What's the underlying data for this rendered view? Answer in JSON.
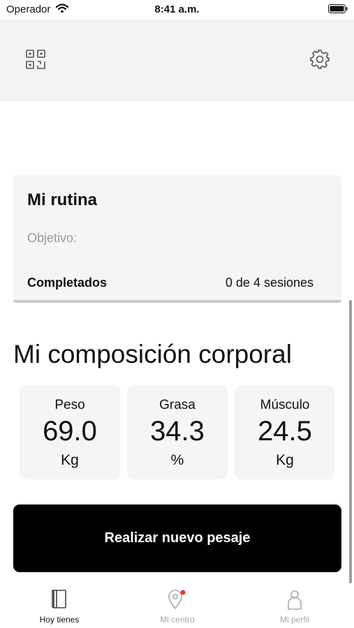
{
  "status_bar": {
    "carrier": "Operador",
    "time": "8:41 a.m.",
    "icons": [
      "wifi-icon",
      "battery-icon"
    ]
  },
  "header": {
    "left_icon": "qr-code-icon",
    "right_icon": "gear-icon"
  },
  "routine": {
    "title": "Mi rutina",
    "objective_label": "Objetivo:",
    "completed_label": "Completados",
    "sessions_text": "0 de 4 sesiones"
  },
  "composition": {
    "title": "Mi composición corporal",
    "metrics": [
      {
        "label": "Peso",
        "value": "69.0",
        "unit": "Kg"
      },
      {
        "label": "Grasa",
        "value": "34.3",
        "unit": "%"
      },
      {
        "label": "Músculo",
        "value": "24.5",
        "unit": "Kg"
      }
    ]
  },
  "primary_button": {
    "label": "Realizar nuevo pesaje"
  },
  "tab_bar": {
    "items": [
      {
        "label": "Hoy tienes",
        "icon": "book-icon",
        "active": true
      },
      {
        "label": "Mi centro",
        "icon": "location-pin-icon",
        "active": false,
        "badge": true
      },
      {
        "label": "Mi perfil",
        "icon": "person-icon",
        "active": false
      }
    ],
    "badge_color": "#e53935"
  }
}
